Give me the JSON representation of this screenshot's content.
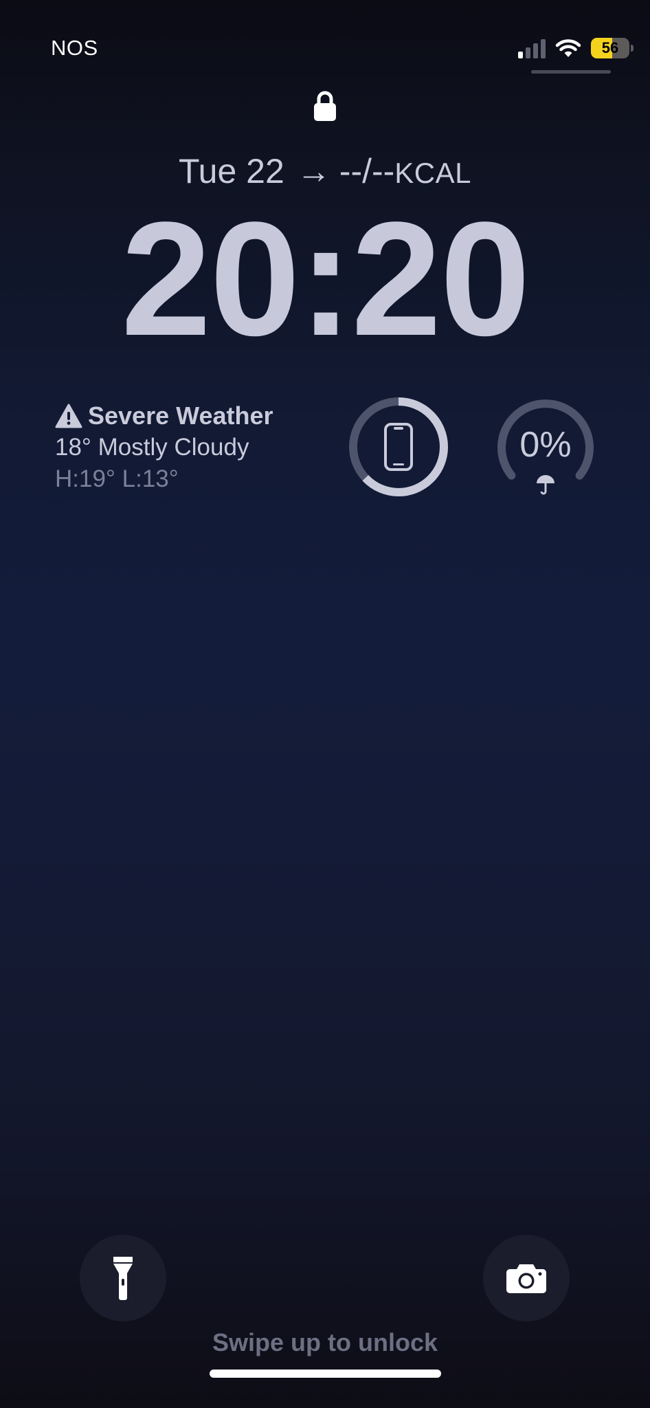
{
  "status_bar": {
    "carrier": "NOS",
    "signal_bars_active": 1,
    "signal_bars_total": 4,
    "battery_level": "56",
    "battery_fraction": 0.56,
    "battery_color": "#f5d31d",
    "icons": [
      "signal-icon",
      "wifi-icon",
      "battery-icon"
    ]
  },
  "lock_screen": {
    "lock_icon": "lock-icon",
    "date": "Tue 22",
    "date_arrow": "→",
    "kcal_value": "--/--",
    "kcal_unit": "KCAL",
    "time": "20:20"
  },
  "weather_widget": {
    "icon": "warning-triangle-icon",
    "alert": "Severe Weather",
    "current": "18° Mostly Cloudy",
    "high_low": "H:19° L:13°"
  },
  "device_battery_widget": {
    "icon": "iphone-icon",
    "level_fraction": 0.63
  },
  "rain_widget": {
    "value": "0%",
    "icon": "umbrella-icon"
  },
  "bottom_controls": {
    "flashlight_icon": "flashlight-icon",
    "camera_icon": "camera-icon",
    "hint": "Swipe up to unlock"
  },
  "colors": {
    "text_primary": "#c9cbdb",
    "text_dim": "#7c8197",
    "ring_track": "#4e546c"
  }
}
